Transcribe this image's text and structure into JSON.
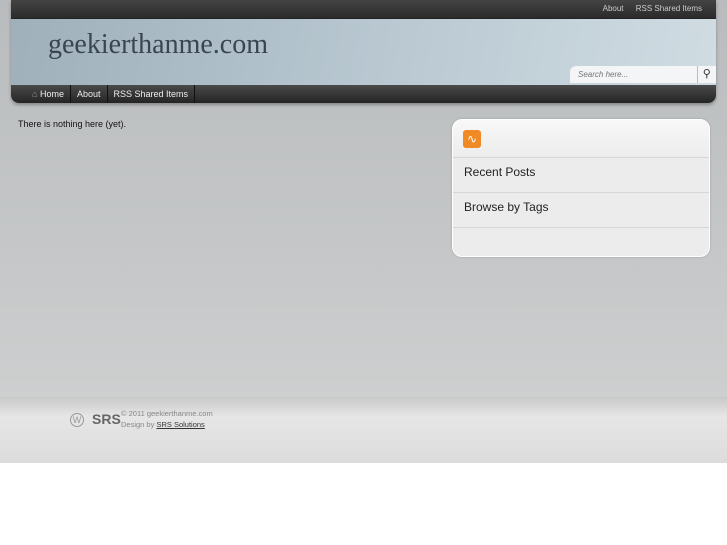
{
  "top_nav": [
    "About",
    "RSS Shared Items"
  ],
  "site_title": "geekierthanme.com",
  "search": {
    "placeholder": "Search here..."
  },
  "main_nav": [
    "Home",
    "About",
    "RSS Shared Items"
  ],
  "content": {
    "message": "There is nothing here (yet)."
  },
  "sidebar": {
    "items": [
      "Recent Posts",
      "Browse by Tags"
    ]
  },
  "footer": {
    "logo": "SRS",
    "copyright": "© 2011 geekierthanme.com",
    "design_by": "Design by",
    "designer": "SRS Solutions"
  }
}
